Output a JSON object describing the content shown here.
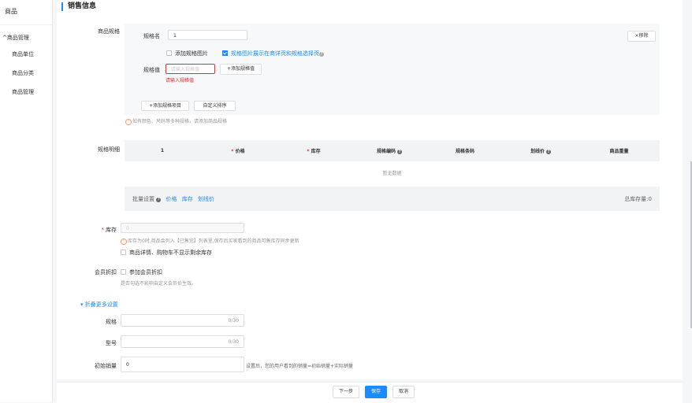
{
  "sidebar": {
    "top_label": "商品",
    "group_label": "商品管理",
    "items": [
      {
        "label": "商品单位"
      },
      {
        "label": "商品分类"
      },
      {
        "label": "商品管理"
      }
    ]
  },
  "section_title": "销售信息",
  "spec": {
    "label": "商品规格",
    "name_label": "规格名",
    "name_value": "1",
    "remove_btn": "×移除",
    "add_image_label": "添加规格图片",
    "show_image_label": "规格图片展示在商详页和规格选择页",
    "value_label": "规格值",
    "value_placeholder": "请输入规格值",
    "add_value_btn": "+添加规格值",
    "value_error": "请输入规格值",
    "add_item_btn": "+添加规格项目",
    "custom_sort_btn": "自定义排序",
    "hint": "如有颜色、尺码等多种规格，请添加商品规格"
  },
  "detail": {
    "label": "规格明细",
    "columns": [
      "1",
      "价格",
      "库存",
      "规格编码",
      "规格条码",
      "划线价",
      "商品重量"
    ],
    "empty_text": "暂无数据",
    "batch_label": "批量设置",
    "batch_links": [
      "价格",
      "库存",
      "划线价"
    ],
    "total_stock": "总库存量:0"
  },
  "stock": {
    "label": "库存",
    "value": "0",
    "hint": "库存为0时,商品会列入【已售完】列表里,保存后买家看到的商品可售库存同步更新",
    "hide_stock_label": "商品详情、购物车不显示剩余库存"
  },
  "member": {
    "label": "会员折扣",
    "checkbox_label": "参加会员折扣",
    "hint": "是否勾选不影响自定义会员价生效。"
  },
  "more_settings": "折叠更多设置",
  "spec_field": {
    "label": "规格",
    "counter": "0/30"
  },
  "model_field": {
    "label": "型号",
    "counter": "0/30"
  },
  "initial_sales": {
    "label": "初始销量",
    "value": "0",
    "hint": "设置后，您的用户看到的销量=初始销量+实际销量"
  },
  "footer": {
    "prev": "下一步",
    "save": "保存",
    "cancel": "取消"
  },
  "colors": {
    "accent": "#1b8cff",
    "error": "#f5222d",
    "warning": "#ff976a"
  }
}
